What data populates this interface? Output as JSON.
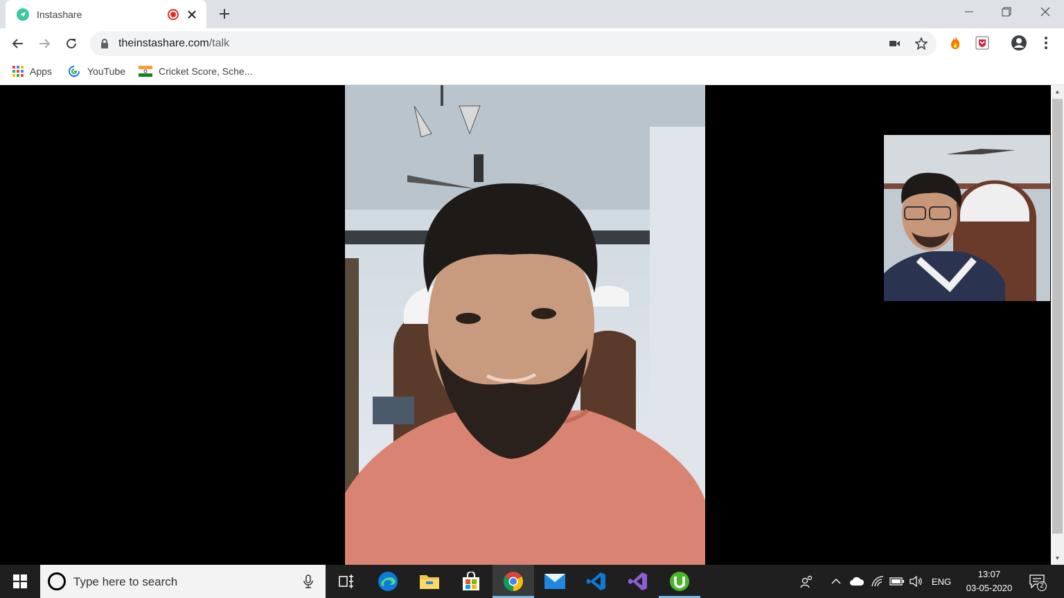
{
  "browser": {
    "tab": {
      "title": "Instashare",
      "favicon": "paper-plane-icon",
      "recording": true
    },
    "address": {
      "domain": "theinstashare.com",
      "path": "/talk"
    },
    "bookmarks": [
      {
        "label": "Apps",
        "icon": "apps-grid-icon"
      },
      {
        "label": "YouTube",
        "icon": "youtube-swirl-icon"
      },
      {
        "label": "Cricket Score, Sche...",
        "icon": "india-flag-icon"
      }
    ],
    "colors": {
      "tabstrip": "#dee1e6",
      "favicon": "#3ec7a0",
      "record": "#d93025"
    }
  },
  "call": {
    "remote_video": {
      "description_icon": "remote-participant-video",
      "background": "#000000"
    },
    "local_video": {
      "description_icon": "self-view-video"
    }
  },
  "taskbar": {
    "search_placeholder": "Type here to search",
    "apps": [
      "task-view-icon",
      "edge-icon",
      "file-explorer-icon",
      "store-icon",
      "chrome-icon",
      "mail-icon",
      "vscode-icon",
      "visual-studio-icon",
      "utorrent-icon"
    ],
    "active_app": "chrome-icon",
    "language": "ENG",
    "time": "13:07",
    "date": "03-05-2020",
    "notification_count": "2"
  }
}
